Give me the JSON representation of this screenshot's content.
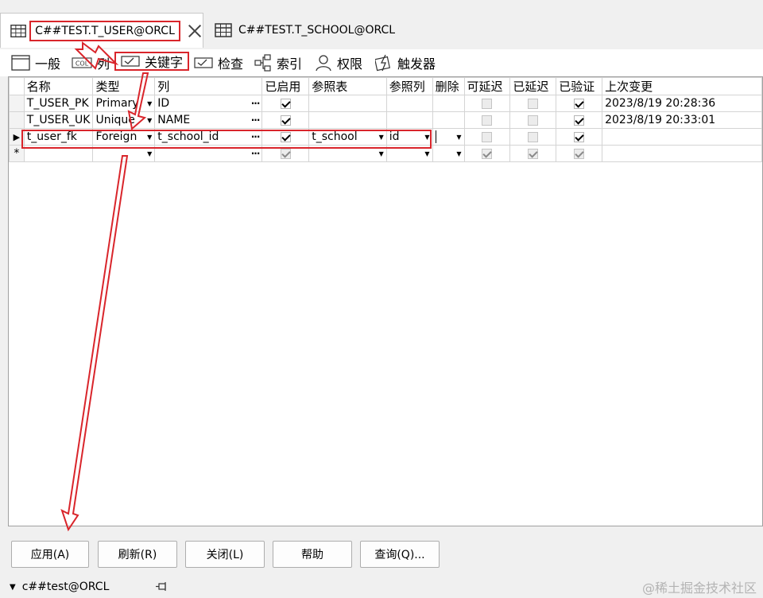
{
  "doc_tabs": [
    {
      "title": "C##TEST.T_USER@ORCL",
      "active": true
    },
    {
      "title": "C##TEST.T_SCHOOL@ORCL",
      "active": false
    }
  ],
  "sub_tabs": [
    {
      "label": "一般",
      "icon": "general-icon"
    },
    {
      "label": "列",
      "icon": "col-icon",
      "icon_text": "COL"
    },
    {
      "label": "关键字",
      "icon": "key-icon",
      "active": true
    },
    {
      "label": "检查",
      "icon": "check-icon"
    },
    {
      "label": "索引",
      "icon": "index-icon"
    },
    {
      "label": "权限",
      "icon": "user-icon"
    },
    {
      "label": "触发器",
      "icon": "trigger-icon"
    }
  ],
  "grid": {
    "headers": [
      "名称",
      "类型",
      "列",
      "已启用",
      "参照表",
      "参照列",
      "删除",
      "可延迟",
      "已延迟",
      "已验证",
      "上次变更"
    ],
    "rows": [
      {
        "name": "T_USER_PK",
        "type": "Primary",
        "column": "ID",
        "enabled": true,
        "ref_table": "",
        "ref_column": "",
        "deferrable": false,
        "deferred": false,
        "validated": true,
        "last_change": "2023/8/19 20:28:36"
      },
      {
        "name": "T_USER_UK",
        "type": "Unique",
        "column": "NAME",
        "enabled": true,
        "ref_table": "",
        "ref_column": "",
        "deferrable": false,
        "deferred": false,
        "validated": true,
        "last_change": "2023/8/19 20:33:01"
      },
      {
        "name": "t_user_fk",
        "type": "Foreign",
        "column": "t_school_id",
        "enabled": true,
        "ref_table": "t_school",
        "ref_column": "id",
        "deferrable": false,
        "deferred": false,
        "validated": true,
        "last_change": ""
      }
    ],
    "new_row_marker": "*"
  },
  "buttons": {
    "apply": "应用(A)",
    "refresh": "刷新(R)",
    "close": "关闭(L)",
    "help": "帮助",
    "query": "查询(Q)..."
  },
  "status": {
    "connection": "c##test@ORCL"
  },
  "watermark": "@稀土掘金技术社区",
  "colors": {
    "annotation_red": "#d9252b"
  }
}
